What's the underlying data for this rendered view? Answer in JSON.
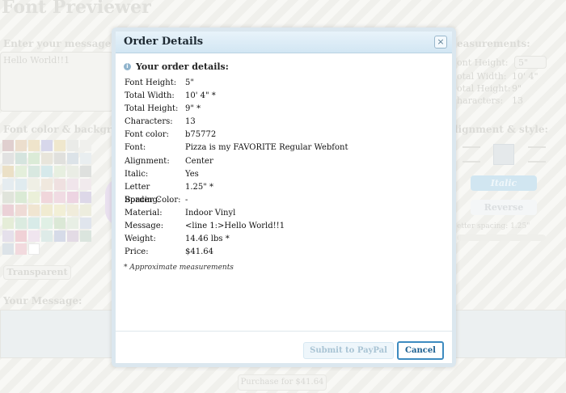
{
  "background": {
    "app_title": "Font Previewer",
    "message_label": "Enter your message he",
    "message_value": "Hello World!!1",
    "measurements_label": "easurements:",
    "font_height_label": "ont Height:",
    "font_height_value": "5\"",
    "total_width_label": "otal Width:",
    "total_width_value": "10' 4\"",
    "total_height_label": "otal Height:",
    "total_height_value": "9\"",
    "characters_label": "haracters:",
    "characters_value": "13",
    "color_label": "Font color & backgroun",
    "alignment_label": "lignment & style:",
    "italic_label": "Italic",
    "reverse_label": "Reverse",
    "letter_spacing_label": "etter spacing: 1.25\"",
    "transparent_label": "Transparent",
    "your_message_label": "Your Message:",
    "purchase_label": "Purchase for $41.64"
  },
  "dialog": {
    "title": "Order Details",
    "close_symbol": "×",
    "section_title": "Your order details:",
    "details": [
      {
        "label": "Font Height:",
        "value": "5\""
      },
      {
        "label": "Total Width:",
        "value": "10' 4\" *"
      },
      {
        "label": "Total Height:",
        "value": "9\" *"
      },
      {
        "label": "Characters:",
        "value": "13"
      },
      {
        "label": "Font color:",
        "value": "b75772"
      },
      {
        "label": "Font:",
        "value": "Pizza is my FAVORITE Regular Webfont"
      },
      {
        "label": "Alignment:",
        "value": "Center"
      },
      {
        "label": "Italic:",
        "value": "Yes"
      },
      {
        "label": "Letter Spacing:",
        "value": "1.25\" *"
      },
      {
        "label": "Border Color:",
        "value": "-"
      },
      {
        "label": "Material:",
        "value": "Indoor Vinyl"
      },
      {
        "label": "Message:",
        "value": "<line 1:>Hello World!!1"
      },
      {
        "label": "Weight:",
        "value": "14.46 lbs *"
      },
      {
        "label": "Price:",
        "value": "$41.64"
      }
    ],
    "note": "* Approximate measurements",
    "submit_label": "Submit to PayPal",
    "cancel_label": "Cancel"
  },
  "colors": {
    "accent": "#3d8bc0",
    "titlebar": "#d2e6f3",
    "font_color": "#b75772"
  }
}
